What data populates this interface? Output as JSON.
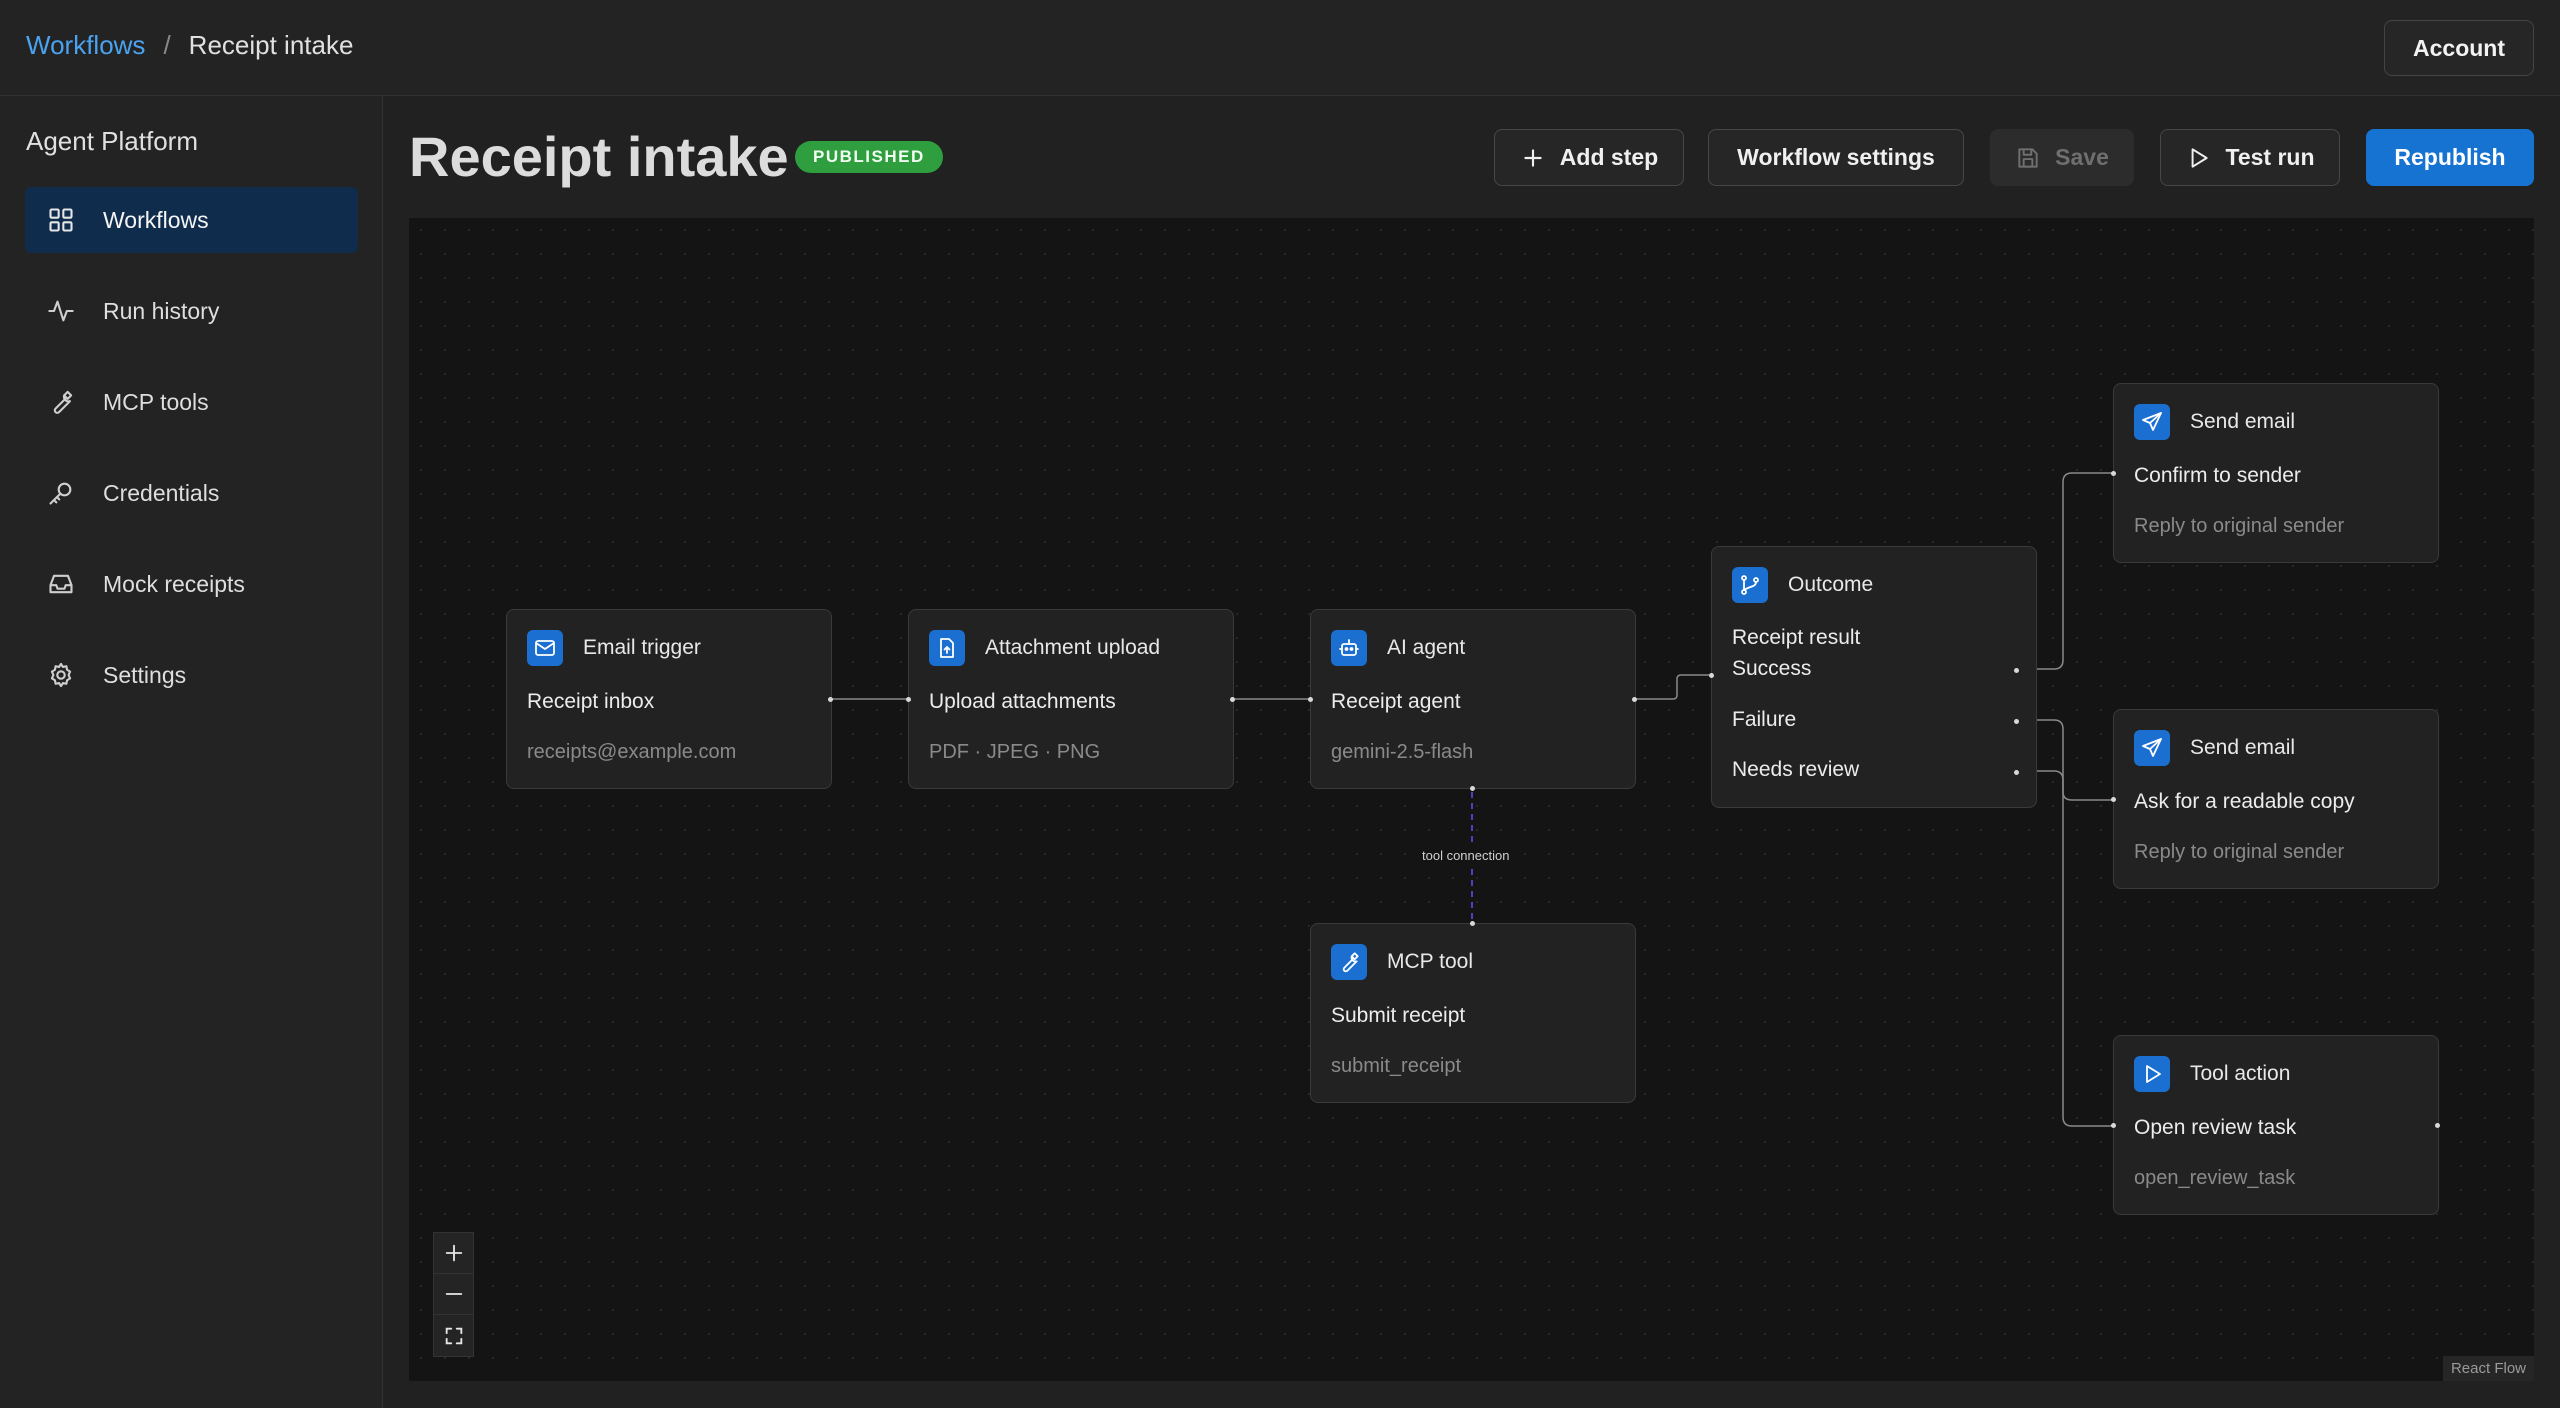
{
  "breadcrumb": {
    "parent": "Workflows",
    "separator": "/",
    "current": "Receipt intake"
  },
  "account": {
    "label": "Account"
  },
  "sidebar": {
    "title": "Agent Platform",
    "items": [
      {
        "label": "Workflows",
        "icon": "grid-icon",
        "active": true
      },
      {
        "label": "Run history",
        "icon": "activity-icon"
      },
      {
        "label": "MCP tools",
        "icon": "wrench-icon"
      },
      {
        "label": "Credentials",
        "icon": "key-icon"
      },
      {
        "label": "Mock receipts",
        "icon": "inbox-icon"
      },
      {
        "label": "Settings",
        "icon": "gear-icon"
      }
    ]
  },
  "header": {
    "title": "Receipt intake",
    "status": "PUBLISHED",
    "status_color": "#2e9e3f",
    "buttons": {
      "add_step": "Add step",
      "workflow_settings": "Workflow settings",
      "save": "Save",
      "test_run": "Test run",
      "republish": "Republish"
    },
    "accent_color": "#1673d1"
  },
  "canvas": {
    "nodes": {
      "email_trigger": {
        "title": "Email trigger",
        "label": "Receipt inbox",
        "sub": "receipts@example.com",
        "icon": "mail-icon"
      },
      "attachment_upload": {
        "title": "Attachment upload",
        "label": "Upload attachments",
        "sub": "PDF · JPEG · PNG",
        "icon": "file-upload-icon"
      },
      "ai_agent": {
        "title": "AI agent",
        "label": "Receipt agent",
        "sub": "gemini-2.5-flash",
        "icon": "bot-icon"
      },
      "mcp_tool": {
        "title": "MCP tool",
        "label": "Submit receipt",
        "sub": "submit_receipt",
        "icon": "wrench-icon"
      },
      "outcome": {
        "title": "Outcome",
        "label": "Receipt result",
        "branches": [
          "Success",
          "Failure",
          "Needs review"
        ],
        "icon": "branch-icon"
      },
      "send_email_1": {
        "title": "Send email",
        "label": "Confirm to sender",
        "sub": "Reply to original sender",
        "icon": "send-icon"
      },
      "send_email_2": {
        "title": "Send email",
        "label": "Ask for a readable copy",
        "sub": "Reply to original sender",
        "icon": "send-icon"
      },
      "tool_action": {
        "title": "Tool action",
        "label": "Open review task",
        "sub": "open_review_task",
        "icon": "play-icon"
      }
    },
    "tool_connection_label": "tool connection",
    "attribution": "React Flow"
  }
}
